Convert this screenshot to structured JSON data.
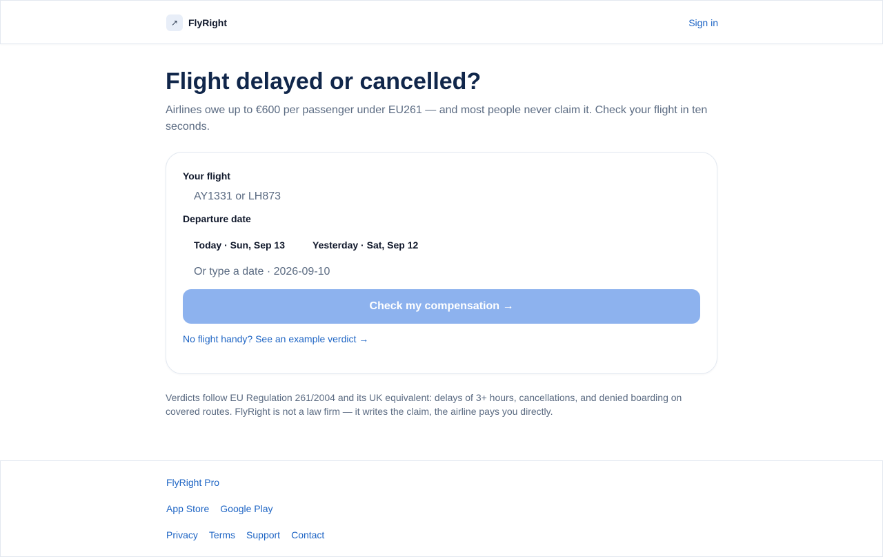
{
  "header": {
    "brand_icon_glyph": "↗",
    "brand_name": "FlyRight",
    "sign_in": "Sign in"
  },
  "hero": {
    "title": "Flight delayed or cancelled?",
    "subtitle": "Airlines owe up to €600 per passenger under EU261 — and most people never claim it. Check your flight in ten seconds."
  },
  "form": {
    "flight_label": "Your flight",
    "flight_placeholder": "AY1331 or LH873",
    "flight_value": "",
    "date_label": "Departure date",
    "date_options": [
      {
        "label": "Today · Sun, Sep 13"
      },
      {
        "label": "Yesterday · Sat, Sep 12"
      }
    ],
    "date_placeholder": "Or type a date · 2026-09-10",
    "date_value": "",
    "submit_label": "Check my compensation →",
    "example_link": "No flight handy? See an example verdict →"
  },
  "disclaimer": "Verdicts follow EU Regulation 261/2004 and its UK equivalent: delays of 3+ hours, cancellations, and denied boarding on covered routes. FlyRight is not a law firm — it writes the claim, the airline pays you directly.",
  "footer": {
    "pro": "FlyRight Pro",
    "app_store": "App Store",
    "google_play": "Google Play",
    "privacy": "Privacy",
    "terms": "Terms",
    "support": "Support",
    "contact": "Contact"
  },
  "colors": {
    "accent_link": "#1d64c4",
    "cta_disabled": "#8db2ee",
    "heading": "#10264a",
    "muted_text": "#5b6b82"
  },
  "icons": {
    "brand": "plane-arrow-icon"
  }
}
